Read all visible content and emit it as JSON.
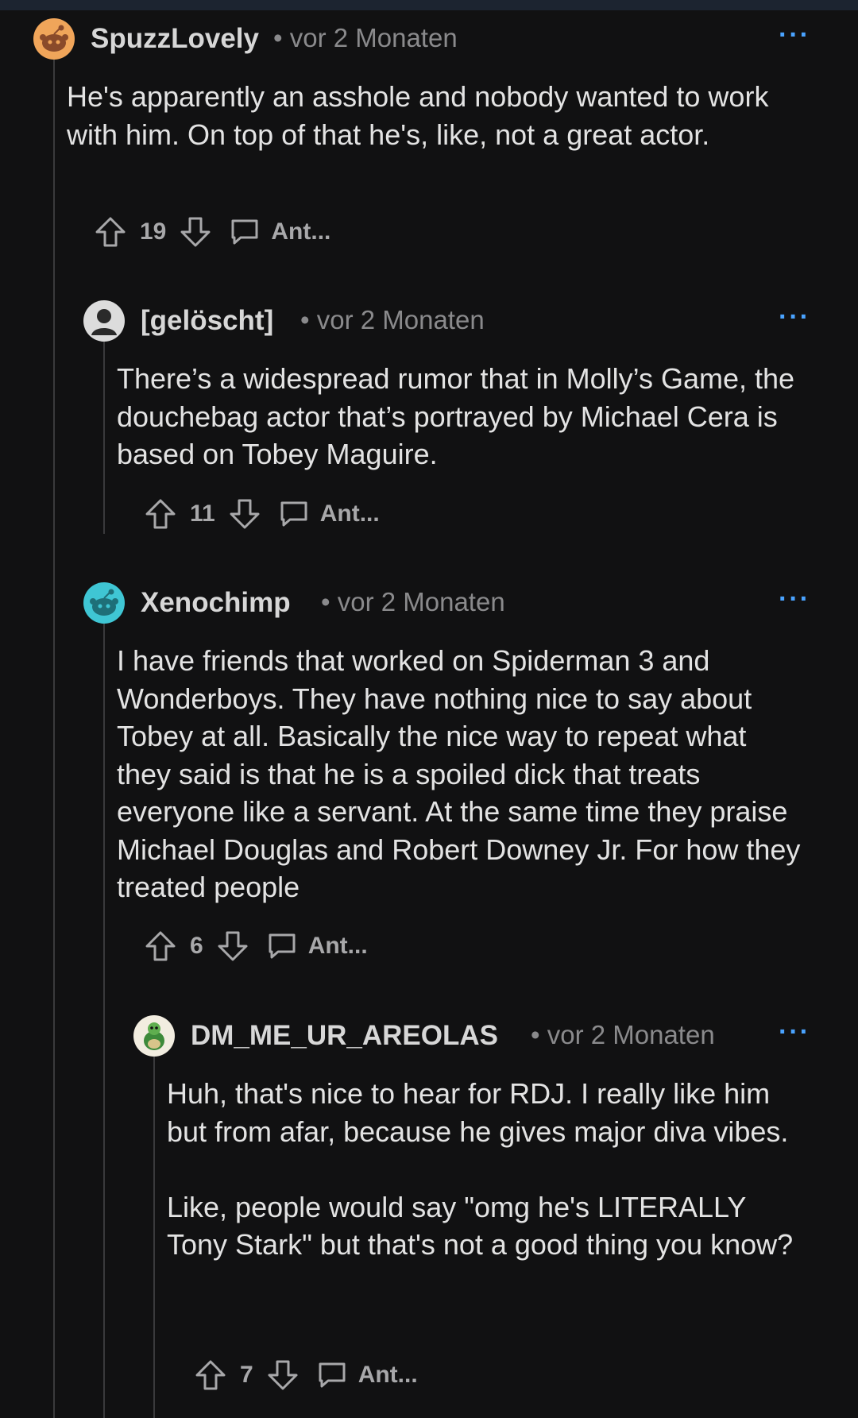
{
  "comments": [
    {
      "username": "SpuzzLovely",
      "time": "• vor 2 Monaten",
      "body": "He's apparently an asshole and nobody wanted to work with him. On top of that he's, like, not a great actor.",
      "score": "19",
      "reply_label": "Ant...",
      "more": "···",
      "avatar_color": "#f0a55a"
    },
    {
      "username": "[gelöscht]",
      "time": "• vor 2 Monaten",
      "body": "There’s a widespread rumor that in Molly’s Game, the douchebag actor that’s portrayed by Michael Cera is based on Tobey Maguire.",
      "score": "11",
      "reply_label": "Ant...",
      "more": "···",
      "avatar_color": "#dcdcdc"
    },
    {
      "username": "Xenochimp",
      "time": "• vor 2 Monaten",
      "body": "I have friends that worked on Spiderman 3 and Wonderboys. They have nothing nice to say about Tobey at all. Basically the nice way to repeat what they said is that he is a spoiled dick that treats everyone like a servant. At the same time they praise Michael Douglas and Robert Downey Jr. For how they treated people",
      "score": "6",
      "reply_label": "Ant...",
      "more": "···",
      "avatar_color": "#3fc6d4"
    },
    {
      "username": "DM_ME_UR_AREOLAS",
      "time": "• vor 2 Monaten",
      "body": "Huh, that's nice to hear for RDJ. I really like him but from afar, because he gives major diva vibes.\n\nLike, people would say \"omg he's LITERALLY Tony Stark\" but that's not a good thing you know?",
      "score": "7",
      "reply_label": "Ant...",
      "more": "···",
      "avatar_color": "#f2ede0"
    }
  ],
  "colors": {
    "background": "#111112",
    "accent": "#4aa3ff",
    "muted": "#8a8a8c"
  }
}
